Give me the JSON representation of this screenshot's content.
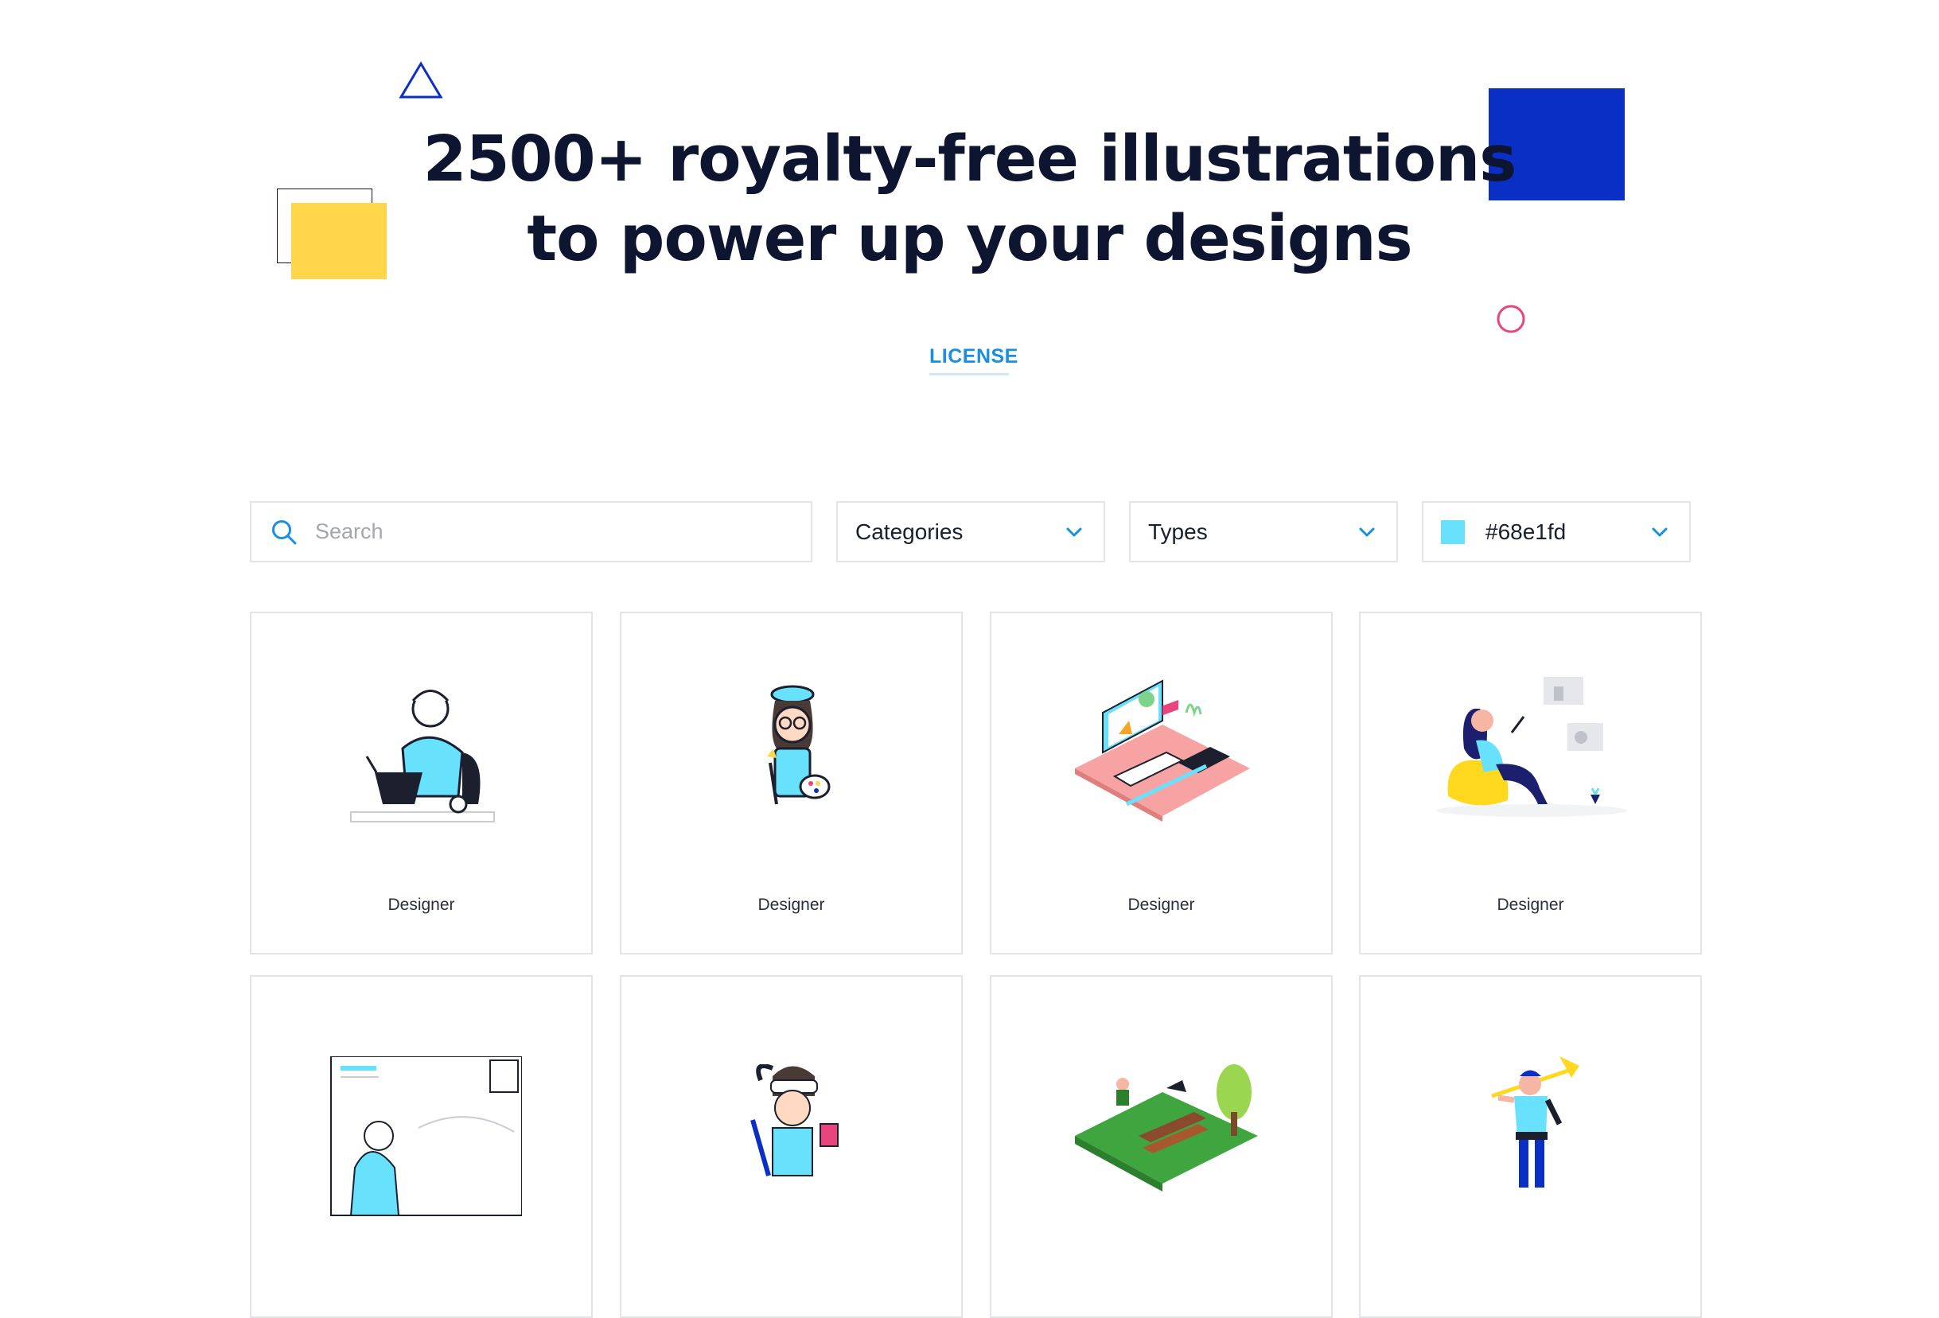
{
  "hero": {
    "title_line1": "2500+ royalty-free illustrations",
    "title_line2": "to power up your designs",
    "license_link": "LICENSE"
  },
  "filters": {
    "search_placeholder": "Search",
    "categories_label": "Categories",
    "types_label": "Types",
    "color_value": "#68e1fd",
    "color_swatch": "#68e1fd"
  },
  "cards": [
    {
      "caption": "Designer",
      "art": "designer-at-laptop-illustration"
    },
    {
      "caption": "Designer",
      "art": "designer-with-palette-illustration"
    },
    {
      "caption": "Designer",
      "art": "isometric-desk-illustration"
    },
    {
      "caption": "Designer",
      "art": "woman-on-beanbag-illustration"
    },
    {
      "caption": "",
      "art": "person-sketching-illustration"
    },
    {
      "caption": "",
      "art": "painter-girl-illustration"
    },
    {
      "caption": "",
      "art": "isometric-park-illustration"
    },
    {
      "caption": "",
      "art": "worker-with-pickaxe-illustration"
    }
  ],
  "colors": {
    "accent_blue": "#0a2fc4",
    "accent_yellow": "#ffd54a",
    "accent_pink": "#e8457c",
    "link_blue": "#1a8fe0",
    "brand_cyan": "#68e1fd"
  }
}
